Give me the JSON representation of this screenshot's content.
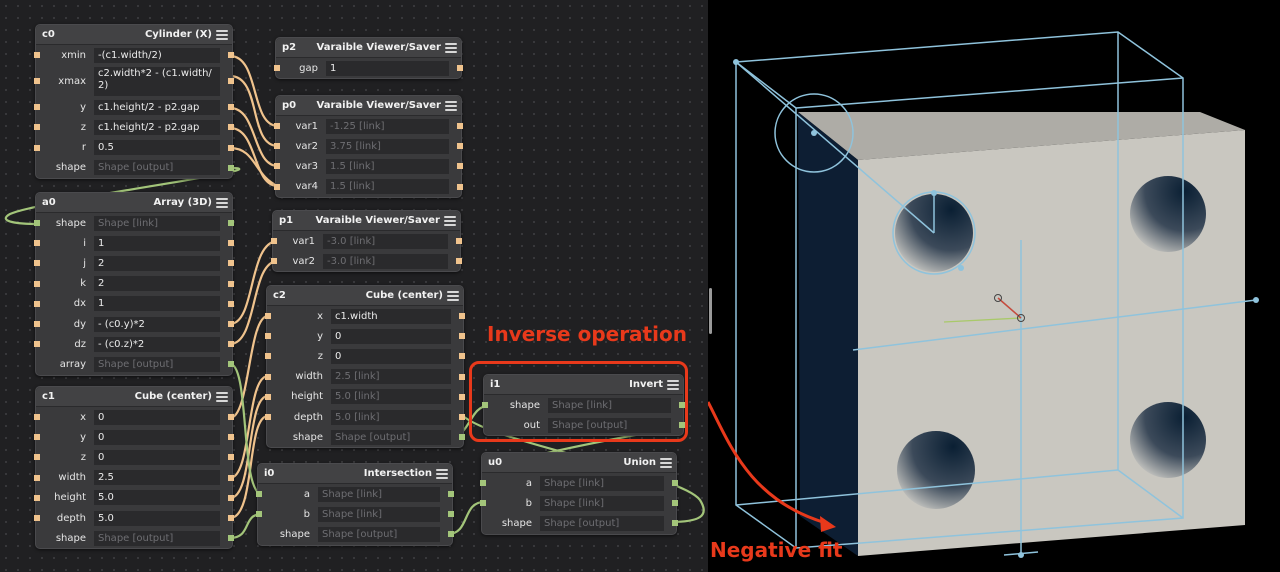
{
  "nodes": {
    "c0": {
      "id": "c0",
      "title": "Cylinder (X)",
      "rows": [
        {
          "label": "xmin",
          "value": "-(c1.width/2)"
        },
        {
          "label": "xmax",
          "value": "c2.width*2 - (c1.width/ 2)"
        },
        {
          "label": "y",
          "value": "c1.height/2 - p2.gap"
        },
        {
          "label": "z",
          "value": "c1.height/2 - p2.gap"
        },
        {
          "label": "r",
          "value": "0.5"
        },
        {
          "label": "shape",
          "value": "Shape [output]"
        }
      ]
    },
    "a0": {
      "id": "a0",
      "title": "Array (3D)",
      "rows": [
        {
          "label": "shape",
          "value": "Shape [link]"
        },
        {
          "label": "i",
          "value": "1"
        },
        {
          "label": "j",
          "value": "2"
        },
        {
          "label": "k",
          "value": "2"
        },
        {
          "label": "dx",
          "value": "1"
        },
        {
          "label": "dy",
          "value": "- (c0.y)*2"
        },
        {
          "label": "dz",
          "value": "- (c0.z)*2"
        },
        {
          "label": "array",
          "value": "Shape [output]"
        }
      ]
    },
    "c1": {
      "id": "c1",
      "title": "Cube (center)",
      "rows": [
        {
          "label": "x",
          "value": "0"
        },
        {
          "label": "y",
          "value": "0"
        },
        {
          "label": "z",
          "value": "0"
        },
        {
          "label": "width",
          "value": "2.5"
        },
        {
          "label": "height",
          "value": "5.0"
        },
        {
          "label": "depth",
          "value": "5.0"
        },
        {
          "label": "shape",
          "value": "Shape [output]"
        }
      ]
    },
    "p2": {
      "id": "p2",
      "title": "Varaible Viewer/Saver",
      "rows": [
        {
          "label": "gap",
          "value": "1"
        }
      ]
    },
    "p0": {
      "id": "p0",
      "title": "Varaible Viewer/Saver",
      "rows": [
        {
          "label": "var1",
          "value": "-1.25 [link]"
        },
        {
          "label": "var2",
          "value": "3.75 [link]"
        },
        {
          "label": "var3",
          "value": "1.5 [link]"
        },
        {
          "label": "var4",
          "value": "1.5 [link]"
        }
      ]
    },
    "p1": {
      "id": "p1",
      "title": "Varaible Viewer/Saver",
      "rows": [
        {
          "label": "var1",
          "value": "-3.0 [link]"
        },
        {
          "label": "var2",
          "value": "-3.0 [link]"
        }
      ]
    },
    "c2": {
      "id": "c2",
      "title": "Cube (center)",
      "rows": [
        {
          "label": "x",
          "value": "c1.width"
        },
        {
          "label": "y",
          "value": "0"
        },
        {
          "label": "z",
          "value": "0"
        },
        {
          "label": "width",
          "value": "2.5 [link]"
        },
        {
          "label": "height",
          "value": "5.0 [link]"
        },
        {
          "label": "depth",
          "value": "5.0 [link]"
        },
        {
          "label": "shape",
          "value": "Shape [output]"
        }
      ]
    },
    "i0": {
      "id": "i0",
      "title": "Intersection",
      "rows": [
        {
          "label": "a",
          "value": "Shape [link]"
        },
        {
          "label": "b",
          "value": "Shape [link]"
        },
        {
          "label": "shape",
          "value": "Shape [output]"
        }
      ]
    },
    "i1": {
      "id": "i1",
      "title": "Invert",
      "rows": [
        {
          "label": "shape",
          "value": "Shape [link]"
        },
        {
          "label": "out",
          "value": "Shape [output]"
        }
      ]
    },
    "u0": {
      "id": "u0",
      "title": "Union",
      "rows": [
        {
          "label": "a",
          "value": "Shape [link]"
        },
        {
          "label": "b",
          "value": "Shape [link]"
        },
        {
          "label": "shape",
          "value": "Shape [output]"
        }
      ]
    }
  },
  "annotations": {
    "inverse_operation": "Inverse operation",
    "negative_fit": "Negative fit",
    "color": "#e8391b"
  },
  "colors": {
    "float_port": "#f0c38d",
    "shape_port": "#a3c57a",
    "viewport_bg": "#000000",
    "model_face": "#c9c7c0",
    "bbox_line": "#8fc3dc"
  }
}
